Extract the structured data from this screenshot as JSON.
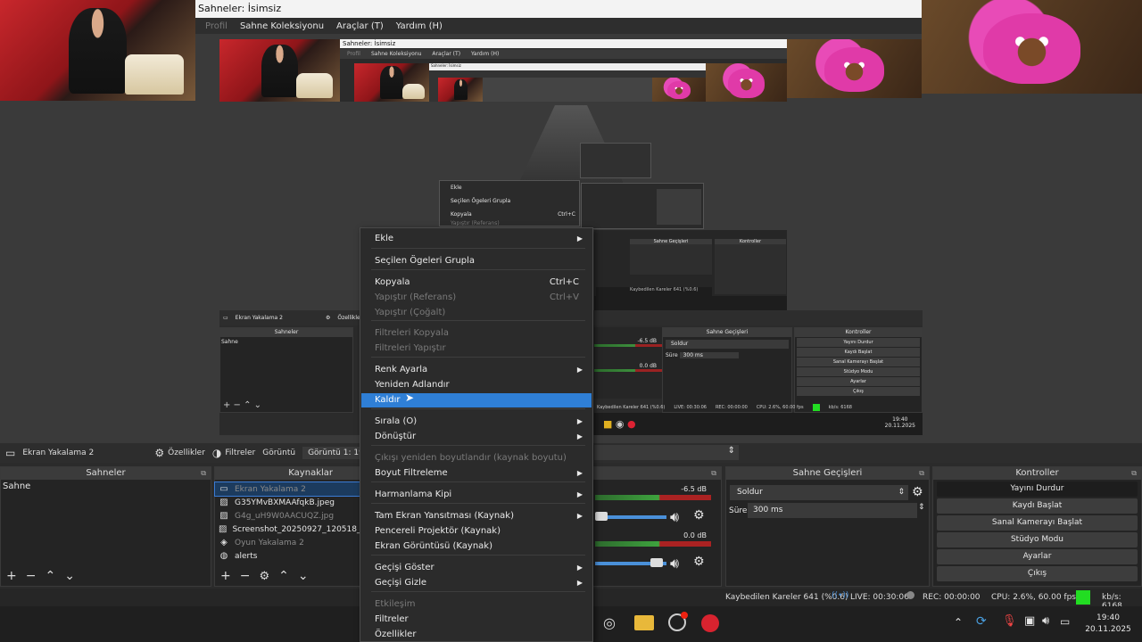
{
  "window": {
    "title": "Sahneler: İsimsiz"
  },
  "menu": {
    "items": [
      "Profil",
      "Sahne Koleksiyonu",
      "Araçlar (T)",
      "Yardım (H)"
    ]
  },
  "toolbar": {
    "source_name": "Ekran Yakalama 2",
    "properties_label": "Özellikler",
    "filters_label": "Filtreler",
    "display_label": "Görüntü",
    "display_value": "Görüntü 1: 1920x"
  },
  "scenes": {
    "title": "Sahneler",
    "items": [
      "Sahne"
    ]
  },
  "sources": {
    "title": "Kaynaklar",
    "items": [
      {
        "name": "Ekran Yakalama 2",
        "icon": "monitor-icon",
        "dim": true,
        "selected": true
      },
      {
        "name": "G35YMvBXMAAfqkB.jpeg",
        "icon": "image-icon",
        "dim": false
      },
      {
        "name": "G4g_uH9W0AACUQZ.jpg",
        "icon": "image-icon",
        "dim": true
      },
      {
        "name": "Screenshot_20250927_120518_Instag",
        "icon": "image-icon",
        "dim": false
      },
      {
        "name": "Oyun Yakalama 2",
        "icon": "gamepad-icon",
        "dim": true
      },
      {
        "name": "alerts",
        "icon": "globe-icon",
        "dim": false
      }
    ]
  },
  "mixer": {
    "tracks": [
      {
        "db": "-6.5 dB"
      },
      {
        "db": "0.0 dB"
      }
    ]
  },
  "transitions": {
    "title": "Sahne Geçişleri",
    "type": "Soldur",
    "duration_label": "Süre",
    "duration_value": "300 ms"
  },
  "controls": {
    "title": "Kontroller",
    "buttons": [
      "Yayını Durdur",
      "Kaydı Başlat",
      "Sanal Kamerayı Başlat",
      "Stüdyo Modu",
      "Ayarlar",
      "Çıkış"
    ]
  },
  "status": {
    "dropped": "Kaybedilen Kareler 641 (%0.6)",
    "live": "LIVE: 00:30:06",
    "rec": "REC: 00:00:00",
    "cpu": "CPU: 2.6%, 60.00 fps",
    "kbs": "kb/s: 6168"
  },
  "taskbar": {
    "time": "19:40",
    "date": "20.11.2025"
  },
  "context_menu": {
    "items": [
      {
        "label": "Ekle",
        "submenu": true
      },
      {
        "label": "Seçilen Ögeleri Grupla"
      },
      {
        "label": "Kopyala",
        "shortcut": "Ctrl+C"
      },
      {
        "label": "Yapıştır (Referans)",
        "shortcut": "Ctrl+V",
        "disabled": true
      },
      {
        "label": "Yapıştır (Çoğalt)",
        "disabled": true
      },
      {
        "label": "Filtreleri Kopyala",
        "disabled": true
      },
      {
        "label": "Filtreleri Yapıştır",
        "disabled": true
      },
      {
        "label": "Renk Ayarla",
        "submenu": true
      },
      {
        "label": "Yeniden Adlandır"
      },
      {
        "label": "Kaldır",
        "selected": true
      },
      {
        "label": "Sırala (O)",
        "submenu": true
      },
      {
        "label": "Dönüştür",
        "submenu": true
      },
      {
        "label": "Çıkışı yeniden boyutlandır (kaynak boyutu)",
        "disabled": true
      },
      {
        "label": "Boyut Filtreleme",
        "submenu": true
      },
      {
        "label": "Harmanlama Kipi",
        "submenu": true
      },
      {
        "label": "Tam Ekran Yansıtması (Kaynak)",
        "submenu": true
      },
      {
        "label": "Pencereli Projektör (Kaynak)"
      },
      {
        "label": "Ekran Görüntüsü (Kaynak)"
      },
      {
        "label": "Geçişi Göster",
        "submenu": true
      },
      {
        "label": "Geçişi Gizle",
        "submenu": true
      },
      {
        "label": "Etkileşim",
        "disabled": true
      },
      {
        "label": "Filtreler"
      },
      {
        "label": "Özellikler"
      }
    ]
  },
  "nested": {
    "title": "Sahneler: İsimsiz",
    "menu": [
      "Profil",
      "Sahne Koleksiyonu",
      "Araçlar (T)",
      "Yardım (H)"
    ],
    "ctx": [
      "Ekle",
      "Seçilen Ögeleri Grupla",
      "Kopyala",
      "Yapıştır (Referans)"
    ],
    "ctx_shortcuts": [
      "Ctrl+C",
      "Ctrl+V"
    ],
    "toolbar_source": "Ekran Yakalama 2",
    "toolbar_props": "Özellikler",
    "scenes_title": "Sahneler",
    "scene_item": "Sahne",
    "transitions_title": "Sahne Geçişleri",
    "transition_type": "Soldur",
    "duration": "Süre",
    "duration_value": "300 ms",
    "controls_title": "Kontroller",
    "controls": [
      "Yayını Durdur",
      "Kaydı Başlat",
      "Sanal Kamerayı Başlat",
      "Stüdyo Modu",
      "Ayarlar",
      "Çıkış"
    ],
    "db1": "-6.5 dB",
    "db2": "0.0 dB",
    "status_dropped": "Kaybedilen Kareler 641 (%0.6)",
    "status_live": "LIVE: 00:30:06",
    "status_rec": "REC: 00:00:00",
    "status_cpu": "CPU: 2.6%, 60.00 fps",
    "status_kbs": "kb/s: 6168",
    "time": "19:40",
    "date": "20.11.2025"
  },
  "colors": {
    "accent": "#2f7fd6",
    "obs_bg": "#2b2b2b",
    "panel": "#242424",
    "status_green": "#22dd22"
  }
}
